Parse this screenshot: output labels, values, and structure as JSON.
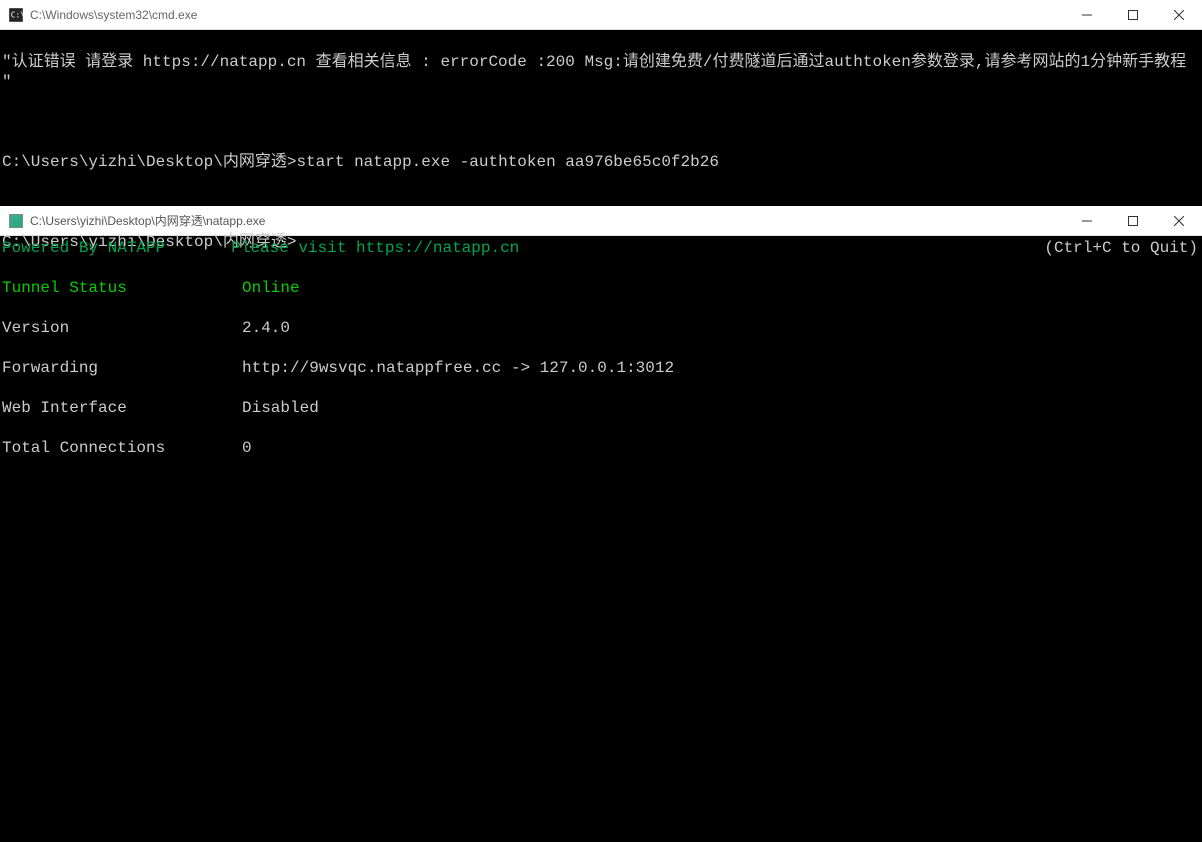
{
  "cmd_window": {
    "title": "C:\\Windows\\system32\\cmd.exe",
    "error_line": "\"认证错误 请登录 https://natapp.cn 查看相关信息 : errorCode :200 Msg:请创建免费/付费隧道后通过authtoken参数登录,请参考网站的1分钟新手教程   \"",
    "prompt1": "C:\\Users\\yizhi\\Desktop\\内网穿透>",
    "command1": "start natapp.exe -authtoken aa976be65c0f2b26",
    "prompt2": "C:\\Users\\yizhi\\Desktop\\内网穿透>"
  },
  "natapp_window": {
    "title": "C:\\Users\\yizhi\\Desktop\\内网穿透\\natapp.exe",
    "powered_by": "Powered By NATAPP",
    "visit_text": "Please visit https://natapp.cn",
    "quit_hint": "(Ctrl+C to Quit)",
    "rows": {
      "tunnel_status_label": "Tunnel Status",
      "tunnel_status_value": "Online",
      "version_label": "Version",
      "version_value": "2.4.0",
      "forwarding_label": "Forwarding",
      "forwarding_value": "http://9wsvqc.natappfree.cc -> 127.0.0.1:3012",
      "web_interface_label": "Web Interface",
      "web_interface_value": "Disabled",
      "total_connections_label": "Total Connections",
      "total_connections_value": "0"
    }
  }
}
